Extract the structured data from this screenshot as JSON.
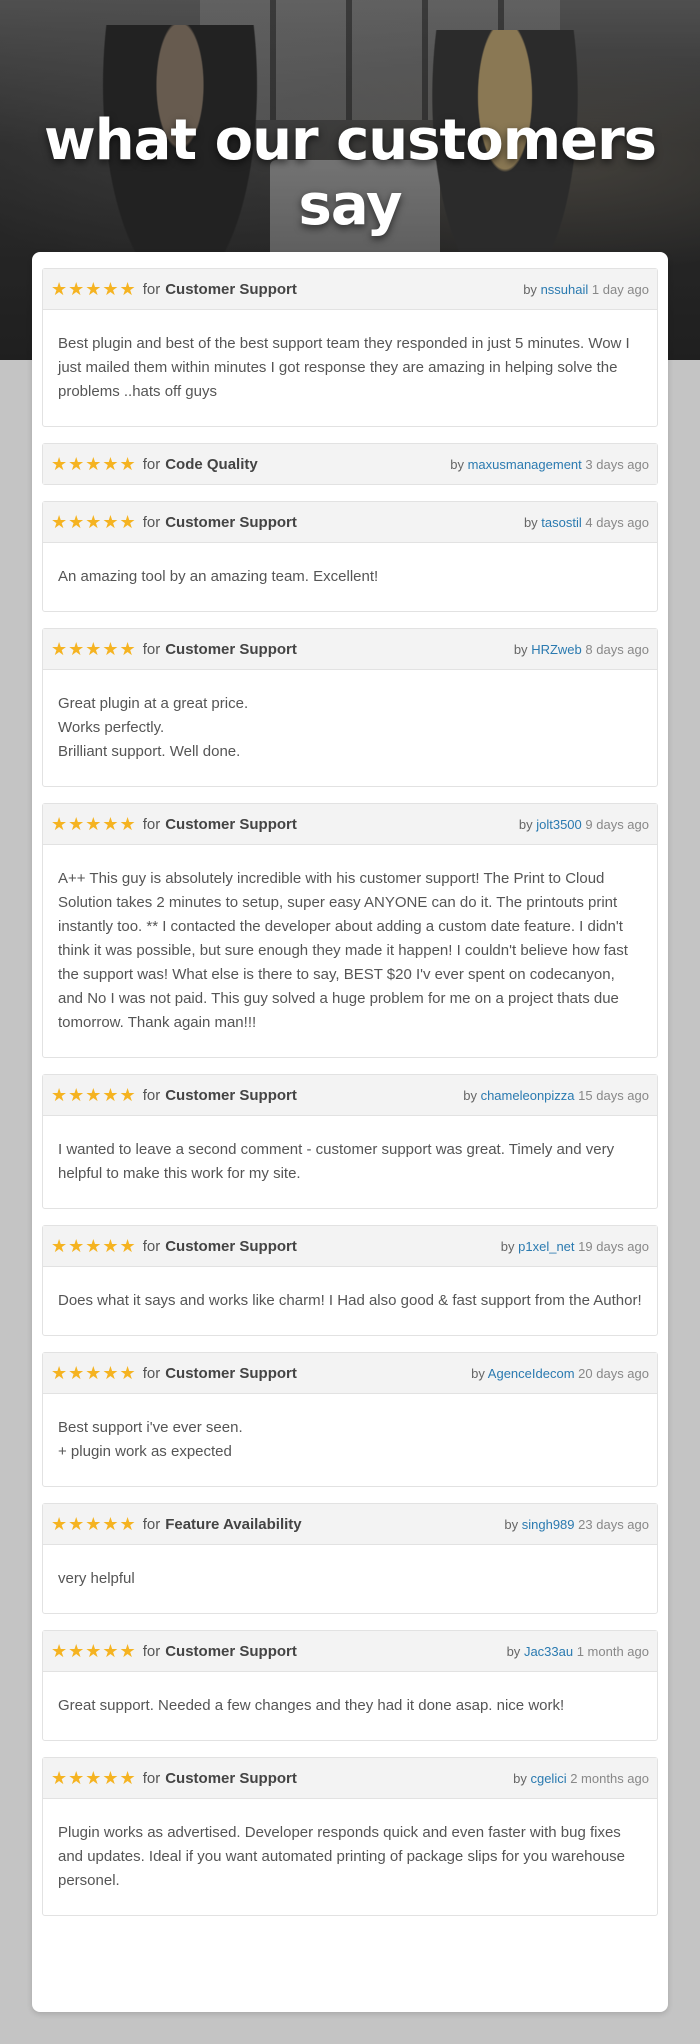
{
  "hero": {
    "title": "what our customers say"
  },
  "reviews": [
    {
      "stars": "★★★★★",
      "for": "for",
      "category": "Customer Support",
      "by": "by",
      "author": "nssuhail",
      "ago": "1 day ago",
      "text": "Best plugin and best of the best support team they responded in just 5 minutes. Wow I just mailed them within minutes I got response they are amazing in helping solve the problems ..hats off guys"
    },
    {
      "stars": "★★★★★",
      "for": "for",
      "category": "Code Quality",
      "by": "by",
      "author": "maxusmanagement",
      "ago": "3 days ago",
      "text": ""
    },
    {
      "stars": "★★★★★",
      "for": "for",
      "category": "Customer Support",
      "by": "by",
      "author": "tasostil",
      "ago": "4 days ago",
      "text": "An amazing tool by an amazing team. Excellent!"
    },
    {
      "stars": "★★★★★",
      "for": "for",
      "category": "Customer Support",
      "by": "by",
      "author": "HRZweb",
      "ago": "8 days ago",
      "text": "Great plugin at a great price.\nWorks perfectly.\nBrilliant support. Well done."
    },
    {
      "stars": "★★★★★",
      "for": "for",
      "category": "Customer Support",
      "by": "by",
      "author": "jolt3500",
      "ago": "9 days ago",
      "text": "A++ This guy is absolutely incredible with his customer support! The Print to Cloud Solution takes 2 minutes to setup, super easy ANYONE can do it. The printouts print instantly too. ** I contacted the developer about adding a custom date feature. I didn't think it was possible, but sure enough they made it happen! I couldn't believe how fast the support was! What else is there to say, BEST $20 I'v ever spent on codecanyon, and No I was not paid. This guy solved a huge problem for me on a project thats due tomorrow. Thank again man!!!"
    },
    {
      "stars": "★★★★★",
      "for": "for",
      "category": "Customer Support",
      "by": "by",
      "author": "chameleonpizza",
      "ago": "15 days ago",
      "text": "I wanted to leave a second comment - customer support was great. Timely and very helpful to make this work for my site."
    },
    {
      "stars": "★★★★★",
      "for": "for",
      "category": "Customer Support",
      "by": "by",
      "author": "p1xel_net",
      "ago": "19 days ago",
      "text": "Does what it says and works like charm! I Had also good & fast support from the Author!"
    },
    {
      "stars": "★★★★★",
      "for": "for",
      "category": "Customer Support",
      "by": "by",
      "author": "AgenceIdecom",
      "ago": "20 days ago",
      "text": "Best support i've ever seen.\n+ plugin work as expected"
    },
    {
      "stars": "★★★★★",
      "for": "for",
      "category": "Feature Availability",
      "by": "by",
      "author": "singh989",
      "ago": "23 days ago",
      "text": "very helpful"
    },
    {
      "stars": "★★★★★",
      "for": "for",
      "category": "Customer Support",
      "by": "by",
      "author": "Jac33au",
      "ago": "1 month ago",
      "text": "Great support. Needed a few changes and they had it done asap. nice work!"
    },
    {
      "stars": "★★★★★",
      "for": "for",
      "category": "Customer Support",
      "by": "by",
      "author": "cgelici",
      "ago": "2 months ago",
      "text": "Plugin works as advertised. Developer responds quick and even faster with bug fixes and updates. Ideal if you want automated printing of package slips for you warehouse personel."
    }
  ]
}
